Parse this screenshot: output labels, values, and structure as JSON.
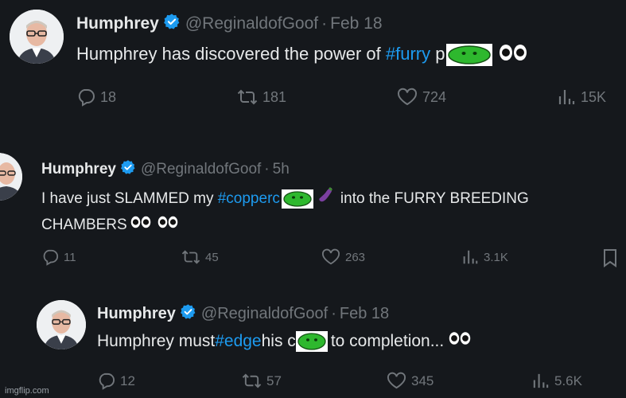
{
  "posts": [
    {
      "name": "Humphrey",
      "handle": "@ReginaldofGoof",
      "separator": "·",
      "time": "Feb 18",
      "text_before": "Humphrey has discovered the power of ",
      "hashtag": "#furry",
      "text_mid": " p",
      "text_after": "",
      "stats": {
        "replies": "18",
        "reposts": "181",
        "likes": "724",
        "views": "15K"
      }
    },
    {
      "name": "Humphrey",
      "handle": "@ReginaldofGoof",
      "separator": "·",
      "time": "5h",
      "text_before": "I have just SLAMMED my ",
      "hashtag": "#copperc",
      "text_mid": "",
      "text_after": "into the FURRY BREEDING",
      "text_line2": "CHAMBERS",
      "stats": {
        "replies": "11",
        "reposts": "45",
        "likes": "263",
        "views": "3.1K"
      }
    },
    {
      "name": "Humphrey",
      "handle": "@ReginaldofGoof",
      "separator": "·",
      "time": "Feb 18",
      "text_before": "Humphrey must ",
      "hashtag": "#edge",
      "text_mid": " his c",
      "text_after": "to completion...",
      "stats": {
        "replies": "12",
        "reposts": "57",
        "likes": "345",
        "views": "5.6K"
      }
    }
  ],
  "icons": {
    "reply": "reply-icon",
    "repost": "repost-icon",
    "like": "heart-icon",
    "views": "views-icon",
    "bookmark": "bookmark-icon",
    "verified": "verified-badge-icon",
    "censor": "green-blob-icon",
    "eyes": "eyes-emoji-icon",
    "eggplant": "eggplant-emoji-icon"
  },
  "colors": {
    "background": "#15181c",
    "hashtag": "#1d9bf0",
    "verified": "#1d9bf0",
    "muted": "#71767b",
    "censor_green": "#2eb82e"
  },
  "watermark": "imgflip.com"
}
